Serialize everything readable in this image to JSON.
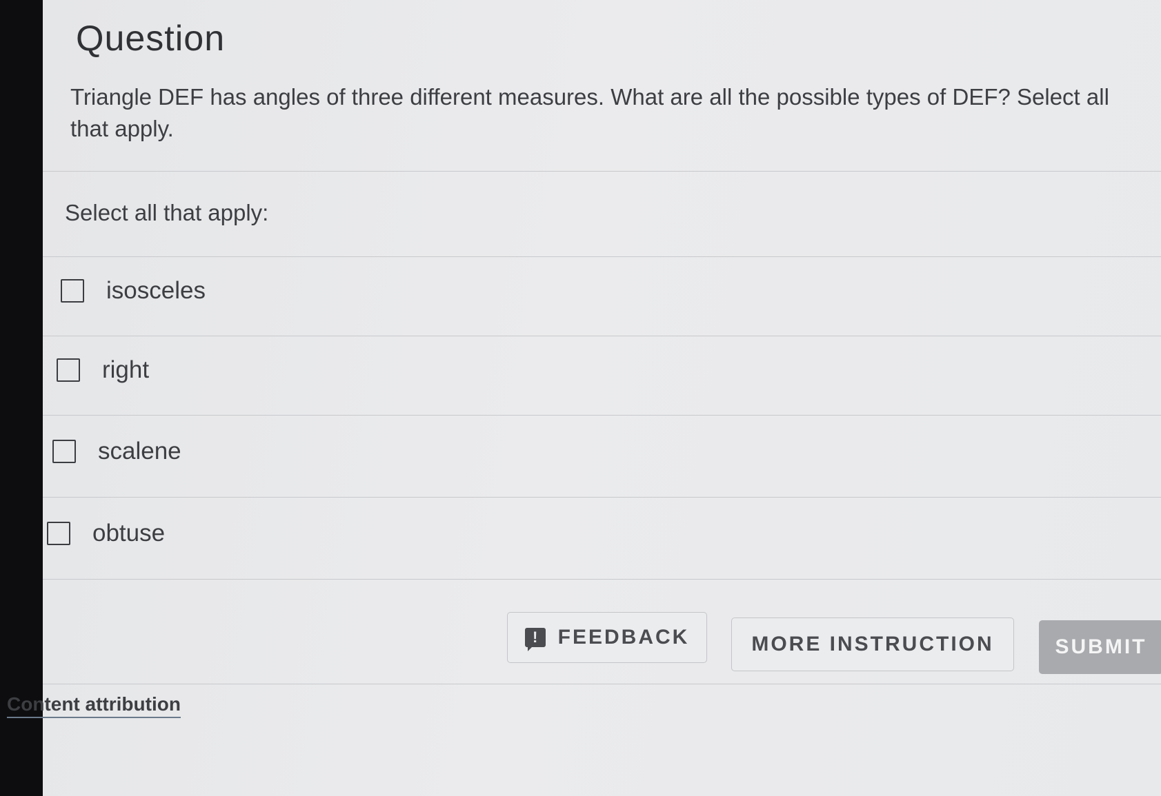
{
  "header": {
    "title": "Question"
  },
  "question": {
    "prompt": "Triangle DEF has angles of three different measures. What are all the possible types of DEF? Select all that apply.",
    "instruction": "Select all that apply:"
  },
  "options": [
    {
      "label": "isosceles",
      "checked": false
    },
    {
      "label": "right",
      "checked": false
    },
    {
      "label": "scalene",
      "checked": false
    },
    {
      "label": "obtuse",
      "checked": false
    }
  ],
  "actions": {
    "feedback_label": "FEEDBACK",
    "feedback_icon": "!",
    "more_instruction_label": "MORE INSTRUCTION",
    "submit_label": "SUBMIT"
  },
  "footer": {
    "attribution_label": "Content attribution"
  },
  "colors": {
    "background": "#e6e7e9",
    "text": "#3c3e42",
    "submit_disabled": "#a9aaad",
    "attribution_underline": "#6b7a8c"
  }
}
